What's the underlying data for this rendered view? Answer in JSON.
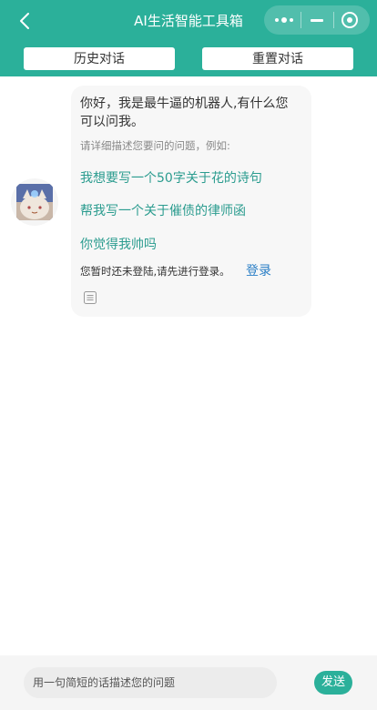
{
  "header": {
    "title": "AI生活智能工具箱",
    "back_icon": "chevron-left-icon",
    "capsule": {
      "more_icon": "more-dots-icon",
      "minimize_icon": "minus-icon",
      "close_icon": "target-circle-icon"
    },
    "history_label": "历史对话",
    "reset_label": "重置对话"
  },
  "bubble": {
    "avatar_icon": "bot-avatar-icon",
    "greeting": "你好，我是最牛逼的机器人,有什么您可以问我。",
    "hint": "请详细描述您要问的问题，例如:",
    "suggestions": [
      "我想要写一个50字关于花的诗句",
      "帮我写一个关于催债的律师函",
      "你觉得我帅吗"
    ],
    "login_tip": "您暂时还未登陆,请先进行登录。",
    "login_link": "登录",
    "copy_icon": "copy-document-icon"
  },
  "footer": {
    "input_placeholder": "用一句简短的话描述您的问题",
    "input_value": "",
    "send_label": "发送"
  },
  "colors": {
    "accent": "#2bb09a",
    "link": "#2b7fc6",
    "suggestion": "#2b9c8f"
  }
}
